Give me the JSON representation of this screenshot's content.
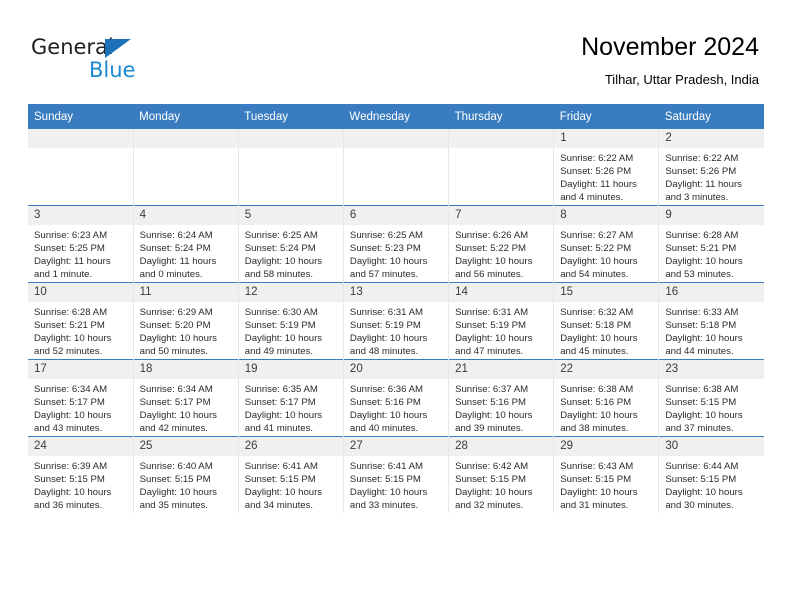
{
  "brand": {
    "name_part1": "General",
    "name_part2": "Blue",
    "triangle_color": "#1b72b8",
    "blue_color": "#1b8ad6"
  },
  "header": {
    "title": "November 2024",
    "subtitle": "Tilhar, Uttar Pradesh, India"
  },
  "theme": {
    "header_blue": "#3a7cc0",
    "daynum_band": "#f0f0f0",
    "cell_divider": "#e8e8e8"
  },
  "weekdays": [
    "Sunday",
    "Monday",
    "Tuesday",
    "Wednesday",
    "Thursday",
    "Friday",
    "Saturday"
  ],
  "weeks": [
    [
      {
        "day": "",
        "lines": []
      },
      {
        "day": "",
        "lines": []
      },
      {
        "day": "",
        "lines": []
      },
      {
        "day": "",
        "lines": []
      },
      {
        "day": "",
        "lines": []
      },
      {
        "day": "1",
        "lines": [
          "Sunrise: 6:22 AM",
          "Sunset: 5:26 PM",
          "Daylight: 11 hours",
          "and 4 minutes."
        ]
      },
      {
        "day": "2",
        "lines": [
          "Sunrise: 6:22 AM",
          "Sunset: 5:26 PM",
          "Daylight: 11 hours",
          "and 3 minutes."
        ]
      }
    ],
    [
      {
        "day": "3",
        "lines": [
          "Sunrise: 6:23 AM",
          "Sunset: 5:25 PM",
          "Daylight: 11 hours",
          "and 1 minute."
        ]
      },
      {
        "day": "4",
        "lines": [
          "Sunrise: 6:24 AM",
          "Sunset: 5:24 PM",
          "Daylight: 11 hours",
          "and 0 minutes."
        ]
      },
      {
        "day": "5",
        "lines": [
          "Sunrise: 6:25 AM",
          "Sunset: 5:24 PM",
          "Daylight: 10 hours",
          "and 58 minutes."
        ]
      },
      {
        "day": "6",
        "lines": [
          "Sunrise: 6:25 AM",
          "Sunset: 5:23 PM",
          "Daylight: 10 hours",
          "and 57 minutes."
        ]
      },
      {
        "day": "7",
        "lines": [
          "Sunrise: 6:26 AM",
          "Sunset: 5:22 PM",
          "Daylight: 10 hours",
          "and 56 minutes."
        ]
      },
      {
        "day": "8",
        "lines": [
          "Sunrise: 6:27 AM",
          "Sunset: 5:22 PM",
          "Daylight: 10 hours",
          "and 54 minutes."
        ]
      },
      {
        "day": "9",
        "lines": [
          "Sunrise: 6:28 AM",
          "Sunset: 5:21 PM",
          "Daylight: 10 hours",
          "and 53 minutes."
        ]
      }
    ],
    [
      {
        "day": "10",
        "lines": [
          "Sunrise: 6:28 AM",
          "Sunset: 5:21 PM",
          "Daylight: 10 hours",
          "and 52 minutes."
        ]
      },
      {
        "day": "11",
        "lines": [
          "Sunrise: 6:29 AM",
          "Sunset: 5:20 PM",
          "Daylight: 10 hours",
          "and 50 minutes."
        ]
      },
      {
        "day": "12",
        "lines": [
          "Sunrise: 6:30 AM",
          "Sunset: 5:19 PM",
          "Daylight: 10 hours",
          "and 49 minutes."
        ]
      },
      {
        "day": "13",
        "lines": [
          "Sunrise: 6:31 AM",
          "Sunset: 5:19 PM",
          "Daylight: 10 hours",
          "and 48 minutes."
        ]
      },
      {
        "day": "14",
        "lines": [
          "Sunrise: 6:31 AM",
          "Sunset: 5:19 PM",
          "Daylight: 10 hours",
          "and 47 minutes."
        ]
      },
      {
        "day": "15",
        "lines": [
          "Sunrise: 6:32 AM",
          "Sunset: 5:18 PM",
          "Daylight: 10 hours",
          "and 45 minutes."
        ]
      },
      {
        "day": "16",
        "lines": [
          "Sunrise: 6:33 AM",
          "Sunset: 5:18 PM",
          "Daylight: 10 hours",
          "and 44 minutes."
        ]
      }
    ],
    [
      {
        "day": "17",
        "lines": [
          "Sunrise: 6:34 AM",
          "Sunset: 5:17 PM",
          "Daylight: 10 hours",
          "and 43 minutes."
        ]
      },
      {
        "day": "18",
        "lines": [
          "Sunrise: 6:34 AM",
          "Sunset: 5:17 PM",
          "Daylight: 10 hours",
          "and 42 minutes."
        ]
      },
      {
        "day": "19",
        "lines": [
          "Sunrise: 6:35 AM",
          "Sunset: 5:17 PM",
          "Daylight: 10 hours",
          "and 41 minutes."
        ]
      },
      {
        "day": "20",
        "lines": [
          "Sunrise: 6:36 AM",
          "Sunset: 5:16 PM",
          "Daylight: 10 hours",
          "and 40 minutes."
        ]
      },
      {
        "day": "21",
        "lines": [
          "Sunrise: 6:37 AM",
          "Sunset: 5:16 PM",
          "Daylight: 10 hours",
          "and 39 minutes."
        ]
      },
      {
        "day": "22",
        "lines": [
          "Sunrise: 6:38 AM",
          "Sunset: 5:16 PM",
          "Daylight: 10 hours",
          "and 38 minutes."
        ]
      },
      {
        "day": "23",
        "lines": [
          "Sunrise: 6:38 AM",
          "Sunset: 5:15 PM",
          "Daylight: 10 hours",
          "and 37 minutes."
        ]
      }
    ],
    [
      {
        "day": "24",
        "lines": [
          "Sunrise: 6:39 AM",
          "Sunset: 5:15 PM",
          "Daylight: 10 hours",
          "and 36 minutes."
        ]
      },
      {
        "day": "25",
        "lines": [
          "Sunrise: 6:40 AM",
          "Sunset: 5:15 PM",
          "Daylight: 10 hours",
          "and 35 minutes."
        ]
      },
      {
        "day": "26",
        "lines": [
          "Sunrise: 6:41 AM",
          "Sunset: 5:15 PM",
          "Daylight: 10 hours",
          "and 34 minutes."
        ]
      },
      {
        "day": "27",
        "lines": [
          "Sunrise: 6:41 AM",
          "Sunset: 5:15 PM",
          "Daylight: 10 hours",
          "and 33 minutes."
        ]
      },
      {
        "day": "28",
        "lines": [
          "Sunrise: 6:42 AM",
          "Sunset: 5:15 PM",
          "Daylight: 10 hours",
          "and 32 minutes."
        ]
      },
      {
        "day": "29",
        "lines": [
          "Sunrise: 6:43 AM",
          "Sunset: 5:15 PM",
          "Daylight: 10 hours",
          "and 31 minutes."
        ]
      },
      {
        "day": "30",
        "lines": [
          "Sunrise: 6:44 AM",
          "Sunset: 5:15 PM",
          "Daylight: 10 hours",
          "and 30 minutes."
        ]
      }
    ]
  ]
}
